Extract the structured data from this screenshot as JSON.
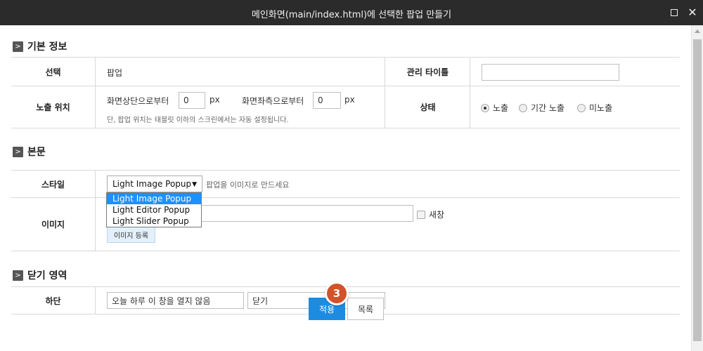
{
  "window": {
    "title": "메인화면(main/index.html)에 선택한 팝업 만들기"
  },
  "basic_info": {
    "section_title": "기본 정보",
    "select_label": "선택",
    "select_value": "팝업",
    "admin_title_label": "관리 타이틀",
    "admin_title_value": "",
    "exposure_position_label": "노출 위치",
    "from_top_label": "화면상단으로부터",
    "from_top_value": "0",
    "from_top_unit": "px",
    "from_left_label": "화면좌측으로부터",
    "from_left_value": "0",
    "from_left_unit": "px",
    "position_hint": "단, 팝업 위치는 태블릿 이하의 스크린에서는 자동 설정됩니다.",
    "status_label": "상태",
    "status_options": [
      "노출",
      "기간 노출",
      "미노출"
    ],
    "status_selected": "노출"
  },
  "body_section": {
    "section_title": "본문",
    "style_label": "스타일",
    "style_selected": "Light Image Popup",
    "style_options": [
      "Light Image Popup",
      "Light Editor Popup",
      "Light Slider Popup"
    ],
    "style_hint": "팝업을 이미지로 만드세요",
    "image_label": "이미지",
    "image_url_value": "",
    "new_window_label": "새창",
    "image_upload_label": "이미지 등록"
  },
  "close_area": {
    "section_title": "닫기 영역",
    "bottom_label": "하단",
    "bottom_text_value": "오늘 하루 이 창을 열지 않음",
    "close_text_value": "닫기"
  },
  "actions": {
    "apply_label": "적용",
    "list_label": "목록",
    "step_badge": "3"
  },
  "colors": {
    "titlebar": "#2b2b2b",
    "primary_button": "#1d8ce0",
    "badge": "#d2522a",
    "dropdown_highlight": "#1e90ff"
  }
}
